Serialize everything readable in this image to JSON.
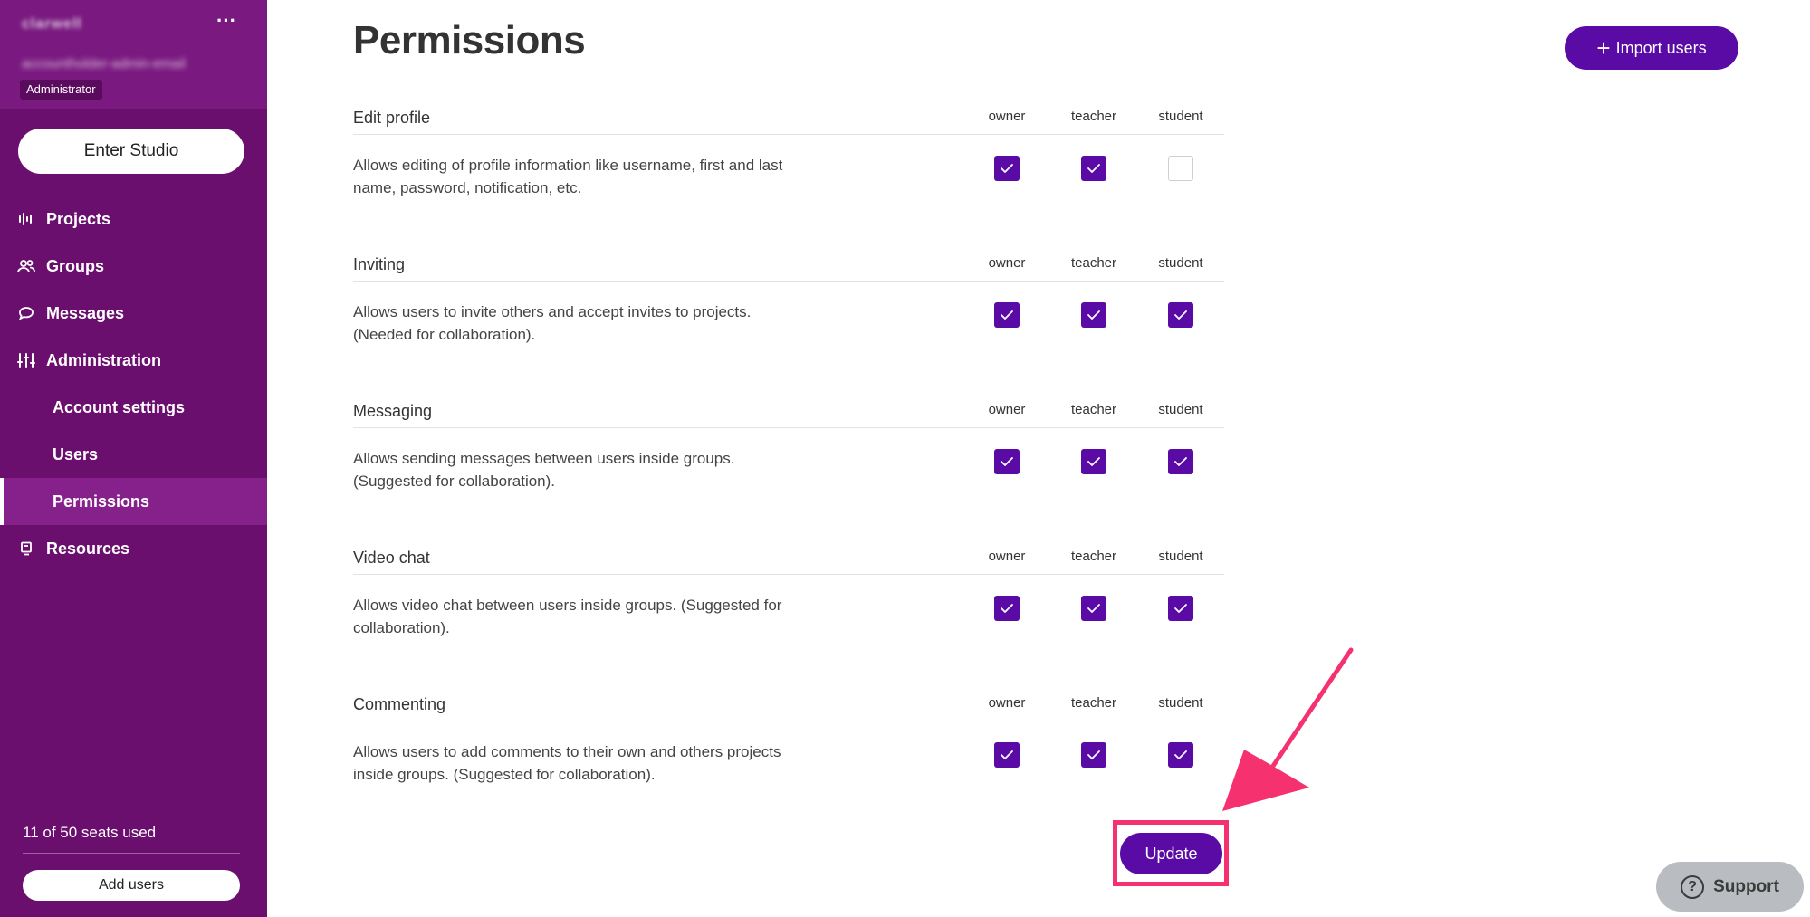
{
  "sidebar": {
    "account_name": "clarwell",
    "user_email": "accountholder-admin-email",
    "role": "Administrator",
    "enter_studio": "Enter Studio",
    "nav": [
      {
        "label": "Projects",
        "icon": "waveform-icon"
      },
      {
        "label": "Groups",
        "icon": "users-icon"
      },
      {
        "label": "Messages",
        "icon": "chat-bubble-icon"
      },
      {
        "label": "Administration",
        "icon": "sliders-icon"
      },
      {
        "label": "Resources",
        "icon": "book-icon"
      }
    ],
    "subnav": [
      "Account settings",
      "Users",
      "Permissions"
    ],
    "active_subnav": "Permissions",
    "seats_text": "11 of 50 seats used",
    "add_users": "Add users"
  },
  "main": {
    "title": "Permissions",
    "import_users": "Import users",
    "update": "Update",
    "support": "Support",
    "colors": {
      "accent": "#5a0aa5",
      "sidebar": "#6b0f6f",
      "highlight": "#f5326f"
    },
    "sections": [
      {
        "title": "Edit profile",
        "roles": [
          "owner",
          "teacher",
          "student"
        ],
        "desc": "Allows editing of profile information like username, first and last name, password, notification, etc.",
        "checked": [
          true,
          true,
          false
        ]
      },
      {
        "title": "Inviting",
        "roles": [
          "owner",
          "teacher",
          "student"
        ],
        "desc": "Allows users to invite others and accept invites to projects. (Needed for collaboration).",
        "checked": [
          true,
          true,
          true
        ]
      },
      {
        "title": "Messaging",
        "roles": [
          "owner",
          "teacher",
          "student"
        ],
        "desc": "Allows sending messages between users inside groups. (Suggested for collaboration).",
        "checked": [
          true,
          true,
          true
        ]
      },
      {
        "title": "Video chat",
        "roles": [
          "owner",
          "teacher",
          "student"
        ],
        "desc": "Allows video chat between users inside groups. (Suggested for collaboration).",
        "checked": [
          true,
          true,
          true
        ]
      },
      {
        "title": "Commenting",
        "roles": [
          "owner",
          "teacher",
          "student"
        ],
        "desc": "Allows users to add comments to their own and others projects inside groups. (Suggested for collaboration).",
        "checked": [
          true,
          true,
          true
        ]
      }
    ]
  }
}
